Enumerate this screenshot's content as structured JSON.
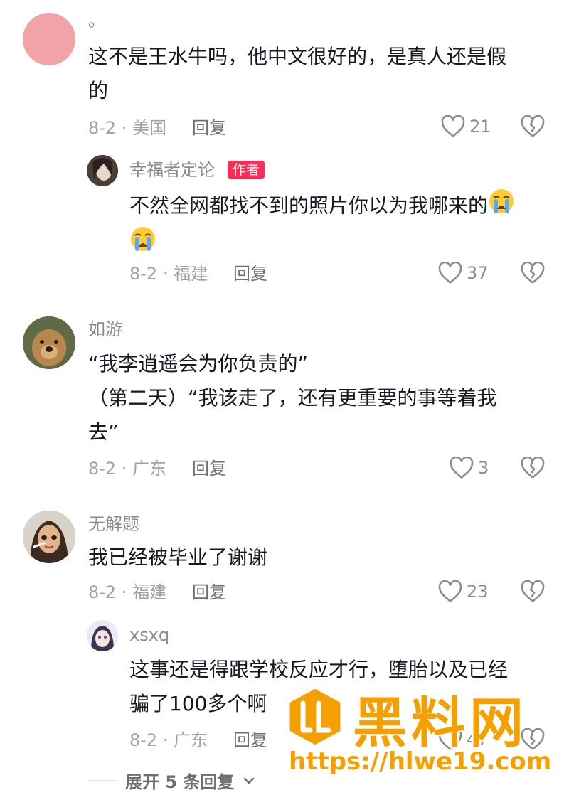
{
  "comments": [
    {
      "username": "。",
      "text_lines": [
        "这不是王水牛吗，他中文很好的，是真人还是假",
        "的"
      ],
      "meta": "8-2 · 美国",
      "reply_label": "回复",
      "likes": "21",
      "avatar_color": "#f2a3a8"
    },
    {
      "username": "幸福者定论",
      "badge": "作者",
      "text_lines": [
        "不然全网都找不到的照片你以为我哪来的"
      ],
      "emoji": "loudly-crying-face",
      "meta": "8-2 · 福建",
      "reply_label": "回复",
      "likes": "37"
    },
    {
      "username": "如游",
      "text_lines": [
        "“我李逍遥会为你负责的”",
        "（第二天）“我该走了，还有更重要的事等着我",
        "去”"
      ],
      "meta": "8-2 · 广东",
      "reply_label": "回复",
      "likes": "3"
    },
    {
      "username": "无解题",
      "text_lines": [
        "我已经被毕业了谢谢"
      ],
      "meta": "8-2 · 福建",
      "reply_label": "回复",
      "likes": "23"
    },
    {
      "username": "xsxq",
      "text_lines": [
        "这事还是得跟学校反应才行，堕胎以及已经",
        "骗了100多个啊"
      ],
      "meta": "8-2 · 广东",
      "reply_label": "回复",
      "likes": "47"
    }
  ],
  "expand_label": "展开 5 条回复",
  "watermark": {
    "title": "黑料网",
    "url": "https://hlwe19.com",
    "color": "#f5a000"
  },
  "icons": {
    "like": "heart-outline-icon",
    "dislike": "broken-heart-icon",
    "expand": "chevron-down-icon"
  }
}
